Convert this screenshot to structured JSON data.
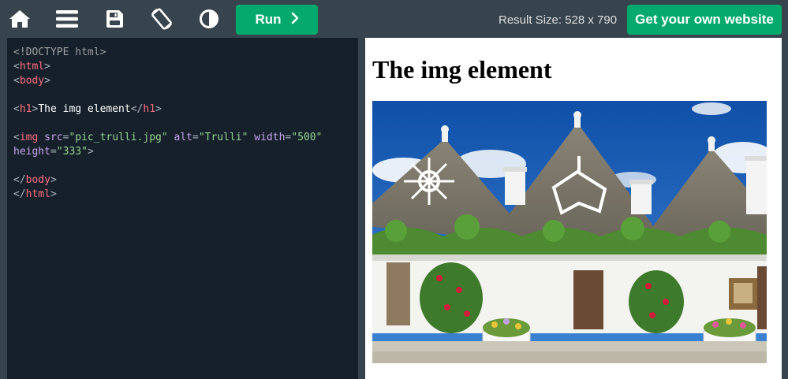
{
  "toolbar": {
    "icons": [
      "home-icon",
      "menu-icon",
      "save-icon",
      "rotate-icon",
      "contrast-icon"
    ],
    "run_label": "Run",
    "result_size": "Result Size: 528 x 790",
    "get_site_label": "Get your own website"
  },
  "colors": {
    "accent": "#04aa6d",
    "toolbar_bg": "#38444d",
    "editor_bg": "#16202a"
  },
  "editor": {
    "lines": [
      "<!DOCTYPE html>",
      "<html>",
      "<body>",
      "",
      "<h1>The img element</h1>",
      "",
      "<img src=\"pic_trulli.jpg\" alt=\"Trulli\" width=\"500\"",
      "height=\"333\">",
      "",
      "</body>",
      "</html>"
    ],
    "tokens": {
      "doctype": "<!DOCTYPE html>",
      "html_open": "html",
      "body_open": "body",
      "h1_tag": "h1",
      "h1_text": "The img element",
      "img_tag": "img",
      "src_attr": "src",
      "src_val": "\"pic_trulli.jpg\"",
      "alt_attr": "alt",
      "alt_val": "\"Trulli\"",
      "width_attr": "width",
      "width_val": "\"500\"",
      "height_attr": "height",
      "height_val": "\"333\"",
      "body_close": "body",
      "html_close": "html"
    }
  },
  "result": {
    "heading": "The img element",
    "image_alt": "Trulli"
  }
}
